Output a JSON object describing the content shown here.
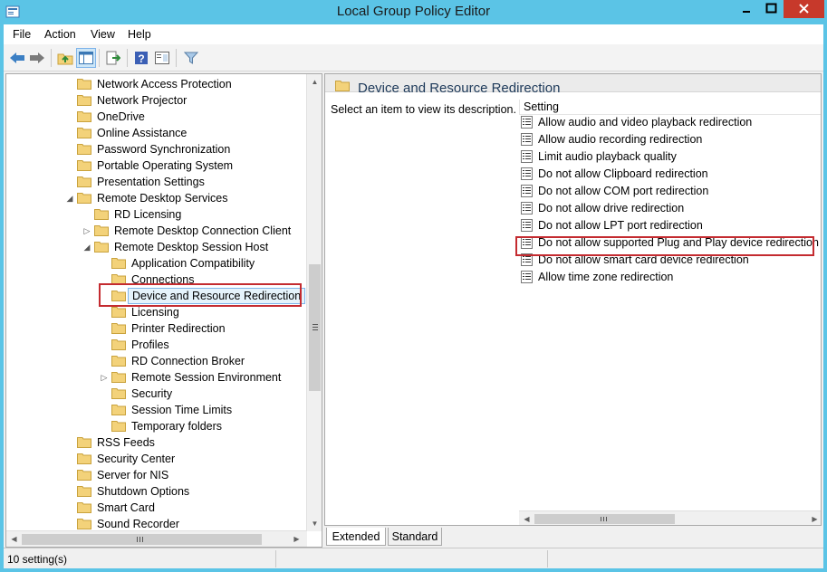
{
  "window": {
    "title": "Local Group Policy Editor",
    "controls": [
      "minimize",
      "maximize",
      "close"
    ]
  },
  "menubar": [
    "File",
    "Action",
    "View",
    "Help"
  ],
  "toolbar": {
    "buttons": [
      "back-arrow-icon",
      "forward-arrow-icon",
      "up-folder-icon",
      "show-hide-tree-icon",
      "export-list-icon",
      "help-icon",
      "properties-icon",
      "filter-icon"
    ],
    "active": "show-hide-tree-icon"
  },
  "tree": {
    "items": [
      {
        "label": "Network Access Protection",
        "level": 0,
        "expander": ""
      },
      {
        "label": "Network Projector",
        "level": 0,
        "expander": ""
      },
      {
        "label": "OneDrive",
        "level": 0,
        "expander": ""
      },
      {
        "label": "Online Assistance",
        "level": 0,
        "expander": ""
      },
      {
        "label": "Password Synchronization",
        "level": 0,
        "expander": ""
      },
      {
        "label": "Portable Operating System",
        "level": 0,
        "expander": ""
      },
      {
        "label": "Presentation Settings",
        "level": 0,
        "expander": ""
      },
      {
        "label": "Remote Desktop Services",
        "level": 0,
        "expander": "expanded"
      },
      {
        "label": "RD Licensing",
        "level": 1,
        "expander": ""
      },
      {
        "label": "Remote Desktop Connection Client",
        "level": 1,
        "expander": "collapsed"
      },
      {
        "label": "Remote Desktop Session Host",
        "level": 1,
        "expander": "expanded"
      },
      {
        "label": "Application Compatibility",
        "level": 2,
        "expander": ""
      },
      {
        "label": "Connections",
        "level": 2,
        "expander": ""
      },
      {
        "label": "Device and Resource Redirection",
        "level": 2,
        "expander": "",
        "selected": true
      },
      {
        "label": "Licensing",
        "level": 2,
        "expander": ""
      },
      {
        "label": "Printer Redirection",
        "level": 2,
        "expander": ""
      },
      {
        "label": "Profiles",
        "level": 2,
        "expander": ""
      },
      {
        "label": "RD Connection Broker",
        "level": 2,
        "expander": ""
      },
      {
        "label": "Remote Session Environment",
        "level": 2,
        "expander": "collapsed"
      },
      {
        "label": "Security",
        "level": 2,
        "expander": ""
      },
      {
        "label": "Session Time Limits",
        "level": 2,
        "expander": ""
      },
      {
        "label": "Temporary folders",
        "level": 2,
        "expander": ""
      },
      {
        "label": "RSS Feeds",
        "level": 0,
        "expander": ""
      },
      {
        "label": "Security Center",
        "level": 0,
        "expander": ""
      },
      {
        "label": "Server for NIS",
        "level": 0,
        "expander": ""
      },
      {
        "label": "Shutdown Options",
        "level": 0,
        "expander": ""
      },
      {
        "label": "Smart Card",
        "level": 0,
        "expander": ""
      },
      {
        "label": "Sound Recorder",
        "level": 0,
        "expander": ""
      }
    ]
  },
  "right_pane": {
    "title": "Device and Resource Redirection",
    "description": "Select an item to view its description.",
    "column_header": "Setting",
    "settings": [
      "Allow audio and video playback redirection",
      "Allow audio recording redirection",
      "Limit audio playback quality",
      "Do not allow Clipboard redirection",
      "Do not allow COM port redirection",
      "Do not allow drive redirection",
      "Do not allow LPT port redirection",
      "Do not allow supported Plug and Play device redirection",
      "Do not allow smart card device redirection",
      "Allow time zone redirection"
    ],
    "highlighted_setting": "Do not allow supported Plug and Play device redirection"
  },
  "tabs": [
    "Extended",
    "Standard"
  ],
  "active_tab": "Extended",
  "status": "10 setting(s)",
  "colors": {
    "titlebar": "#5bc4e6",
    "close_button": "#c7392b",
    "highlight_box": "#c42b30",
    "selection_fill": "#e5f3fb",
    "folder": "#f3d27a"
  }
}
